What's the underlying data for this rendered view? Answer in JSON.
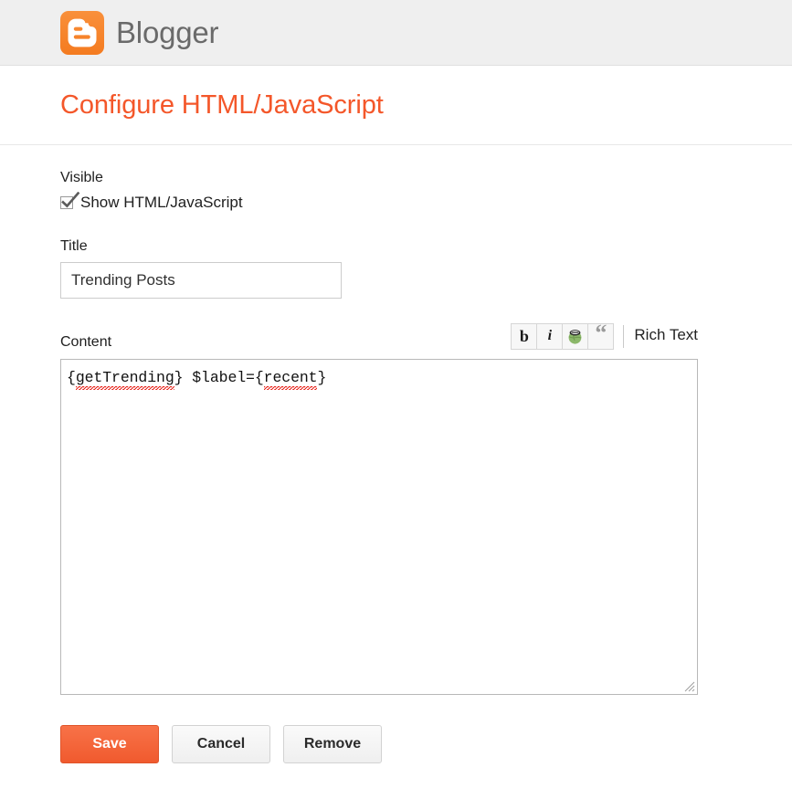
{
  "header": {
    "logo_icon": "blogger-logo-icon",
    "brand": "Blogger",
    "background": "#efefef"
  },
  "page": {
    "title": "Configure HTML/JavaScript",
    "title_color": "#f4572a"
  },
  "form": {
    "visible": {
      "label": "Visible",
      "checkbox_label": "Show HTML/JavaScript",
      "checked": true
    },
    "title_field": {
      "label": "Title",
      "value": "Trending Posts",
      "placeholder": ""
    },
    "content_field": {
      "label": "Content",
      "value": "{getTrending} $label={recent}",
      "value_parts": {
        "prefix": "{",
        "misspelled_1": "getTrending",
        "middle": "} $label={",
        "misspelled_2": "recent",
        "suffix": "}"
      }
    }
  },
  "toolbar": {
    "bold_label": "b",
    "italic_label": "i",
    "link_icon": "link-globe-icon",
    "quote_label": "“",
    "mode_label": "Rich Text"
  },
  "buttons": {
    "save": "Save",
    "cancel": "Cancel",
    "remove": "Remove",
    "save_color": "#f4653c"
  }
}
